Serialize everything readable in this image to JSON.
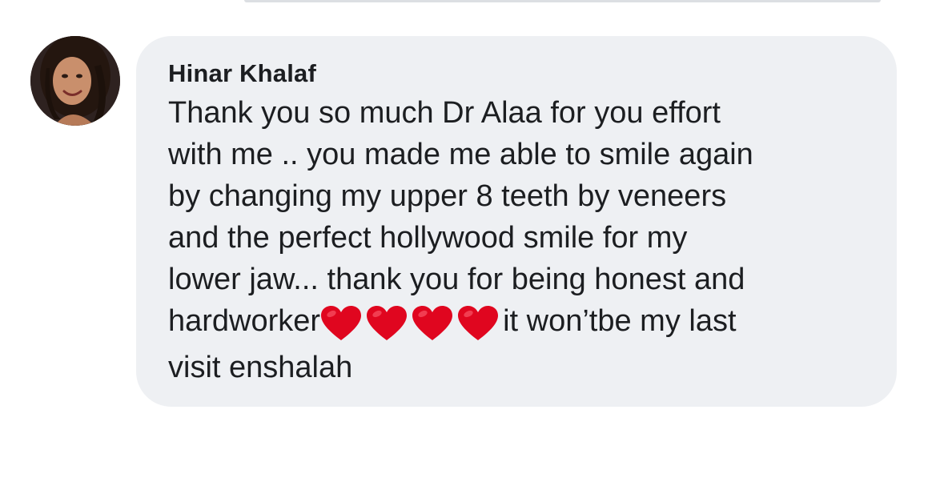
{
  "comment": {
    "author": "Hinar Khalaf",
    "lines": [
      "Thank you so much Dr Alaa for you effort",
      "with me .. you made me able to smile again",
      "by changing my upper 8 teeth by veneers",
      "and the perfect hollywood smile for my",
      "lower jaw... thank you for being honest and"
    ],
    "line6_before": "hardworker",
    "line6_after": "it won’tbe my last",
    "line7": "visit enshalah",
    "emoji": [
      "heart-emoji",
      "heart-emoji",
      "heart-emoji",
      "heart-emoji"
    ]
  },
  "colors": {
    "bubble": "#eef0f3",
    "text": "#1c1e21",
    "heart": "#e0061f"
  }
}
